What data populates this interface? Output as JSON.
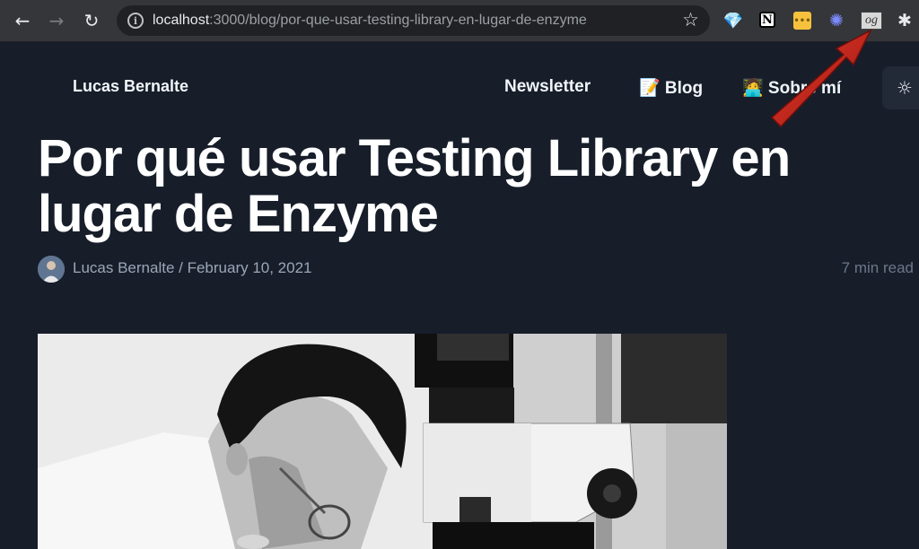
{
  "browser": {
    "url_host": "localhost",
    "url_rest": ":3000/blog/por-que-usar-testing-library-en-lugar-de-enzyme",
    "extensions": [
      "gem-icon",
      "notion-icon",
      "yellow-ext-icon",
      "blue-ext-icon",
      "og-icon",
      "puzzle-icon"
    ],
    "og_label": "og"
  },
  "header": {
    "site_name": "Lucas Bernalte",
    "nav": {
      "newsletter": "Newsletter",
      "blog": "📝 Blog",
      "about": "🧑‍💻 Sobre mí"
    }
  },
  "article": {
    "title": "Por qué usar Testing Library en lugar de Enzyme",
    "byline": "Lucas Bernalte / February 10, 2021",
    "read_time": "7 min read"
  },
  "colors": {
    "page_bg": "#171e2a",
    "arrow": "#c8231c"
  }
}
